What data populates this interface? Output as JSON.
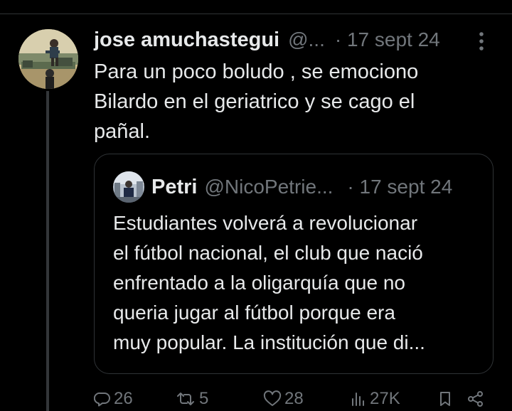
{
  "tweet": {
    "author": {
      "display_name": "jose amuchastegui",
      "handle": "@...",
      "avatar_icon": "profile-photo"
    },
    "date": "· 17 sept 24",
    "text_lines": [
      "Para un poco boludo , se emociono",
      "Bilardo en el geriatrico y se cago el",
      "pañal."
    ],
    "more_icon": "more-vertical-icon"
  },
  "quote": {
    "author": {
      "display_name": "Petri",
      "handle": "@NicoPetrie...",
      "avatar_icon": "profile-photo"
    },
    "date": "· 17 sept 24",
    "text_lines": [
      "Estudiantes volverá a revolucionar",
      "el fútbol nacional, el club que nació",
      "enfrentado a la oligarquía  que no",
      "queria jugar al fútbol porque era",
      "muy popular. La institución que di..."
    ]
  },
  "actions": {
    "replies": {
      "icon": "reply-icon",
      "count": "26"
    },
    "retweets": {
      "icon": "retweet-icon",
      "count": "5"
    },
    "likes": {
      "icon": "heart-icon",
      "count": "28"
    },
    "views": {
      "icon": "analytics-icon",
      "count": "27K"
    },
    "bookmark": {
      "icon": "bookmark-icon"
    },
    "share": {
      "icon": "share-icon"
    }
  },
  "colors": {
    "background": "#000000",
    "text_primary": "#e7e9ea",
    "text_secondary": "#71767b",
    "border": "#2f3336"
  }
}
